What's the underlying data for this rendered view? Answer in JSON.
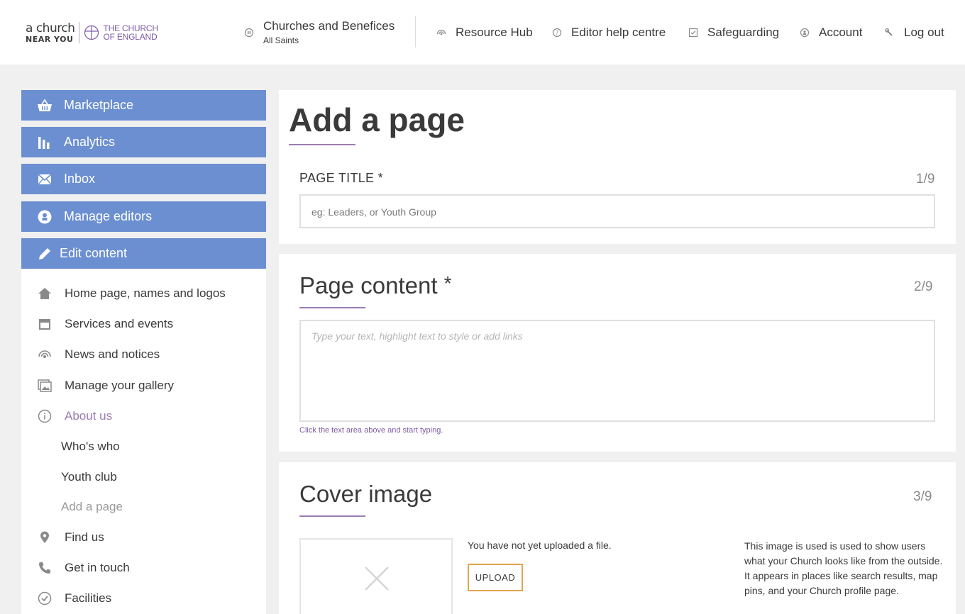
{
  "header": {
    "logo": {
      "acny_line1": "a church",
      "acny_line2": "NEAR YOU",
      "coe_line1": "THE CHURCH",
      "coe_line2": "OF ENGLAND"
    },
    "churches": {
      "title": "Churches and Benefices",
      "subtitle": "All Saints",
      "icon": "grid-icon"
    },
    "nav": [
      {
        "label": "Resource Hub",
        "icon": "broadcast-icon"
      },
      {
        "label": "Editor help centre",
        "icon": "help-icon"
      },
      {
        "label": "Safeguarding",
        "icon": "checkbox-icon"
      },
      {
        "label": "Account",
        "icon": "user-icon"
      },
      {
        "label": "Log out",
        "icon": "wrench-icon"
      }
    ]
  },
  "sidebar": {
    "primary": [
      {
        "label": "Marketplace",
        "icon": "basket-icon"
      },
      {
        "label": "Analytics",
        "icon": "bar-chart-icon"
      },
      {
        "label": "Inbox",
        "icon": "envelope-icon"
      },
      {
        "label": "Manage editors",
        "icon": "user-circle-icon"
      },
      {
        "label": "Edit content",
        "icon": "pencil-icon"
      }
    ],
    "links": [
      {
        "label": "Home page, names and logos",
        "icon": "home-icon"
      },
      {
        "label": "Services and events",
        "icon": "calendar-icon"
      },
      {
        "label": "News and notices",
        "icon": "broadcast-icon"
      },
      {
        "label": "Manage your gallery",
        "icon": "gallery-icon"
      },
      {
        "label": "About us",
        "icon": "info-icon"
      },
      {
        "label": "Find us",
        "icon": "map-pin-icon"
      },
      {
        "label": "Get in touch",
        "icon": "phone-icon"
      },
      {
        "label": "Facilities",
        "icon": "check-circle-icon"
      }
    ],
    "about_sub": [
      "Who's who",
      "Youth club",
      "Add a page"
    ]
  },
  "main": {
    "title": "Add a page",
    "page_title_field": {
      "label": "PAGE TITLE *",
      "step": "1/9",
      "placeholder": "eg: Leaders, or Youth Group",
      "value": ""
    },
    "page_content": {
      "heading": "Page content",
      "required_mark": "*",
      "step": "2/9",
      "placeholder": "Type your text, highlight text to style or add links",
      "hint": "Click the text area above and start typing."
    },
    "cover_image": {
      "heading": "Cover image",
      "step": "3/9",
      "status": "You have not yet uploaded a file.",
      "upload_label": "UPLOAD",
      "info": "This image is used is used to show users what your Church looks like from the outside. It appears in places like search results, map pins, and your Church profile page."
    }
  },
  "colors": {
    "sidebar_button": "#6b8fd1",
    "accent_purple": "#9b7bb3",
    "upload_border": "#e3a44f",
    "background": "#f0f0f0"
  }
}
